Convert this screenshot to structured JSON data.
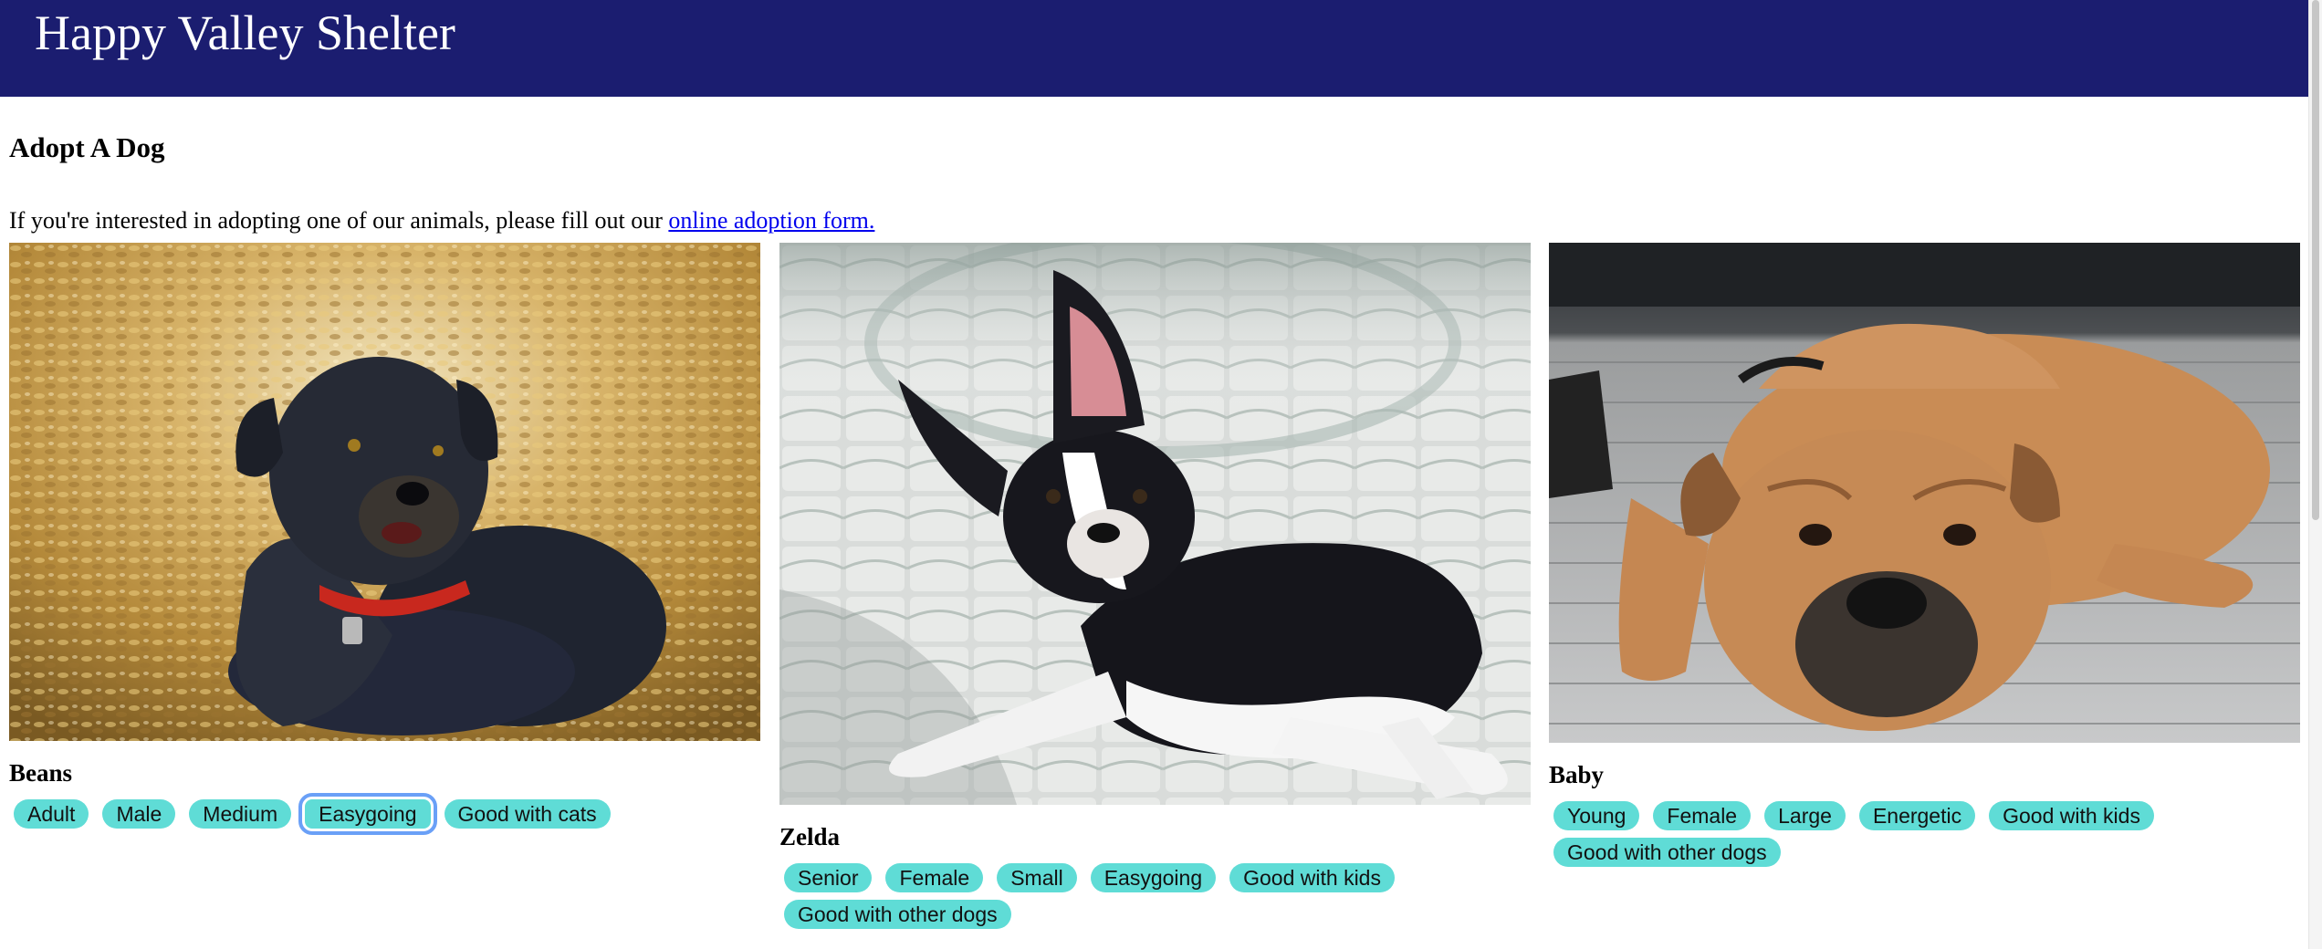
{
  "header": {
    "title": "Happy Valley Shelter"
  },
  "main": {
    "heading": "Adopt A Dog",
    "intro_text": "If you're interested in adopting one of our animals, please fill out our ",
    "intro_link": "online adoption form."
  },
  "dogs": [
    {
      "name": "Beans",
      "photo": "black scruffy terrier mix lying on dry leaves, red collar",
      "tags": [
        "Adult",
        "Male",
        "Medium",
        "Easygoing",
        "Good with cats"
      ],
      "focused_tag": "Easygoing"
    },
    {
      "name": "Zelda",
      "photo": "black and white Boston terrier lying on a tiled patio",
      "tags": [
        "Senior",
        "Female",
        "Small",
        "Easygoing",
        "Good with kids",
        "Good with other dogs"
      ]
    },
    {
      "name": "Baby",
      "photo": "tan bulldog lying on a wooden deck",
      "tags": [
        "Young",
        "Female",
        "Large",
        "Energetic",
        "Good with kids",
        "Good with other dogs"
      ]
    }
  ],
  "colors": {
    "header_bg": "#1b1d70",
    "tag_bg": "#5fdcd6",
    "link": "#0000ee",
    "focus_ring": "#6aa0f7"
  }
}
